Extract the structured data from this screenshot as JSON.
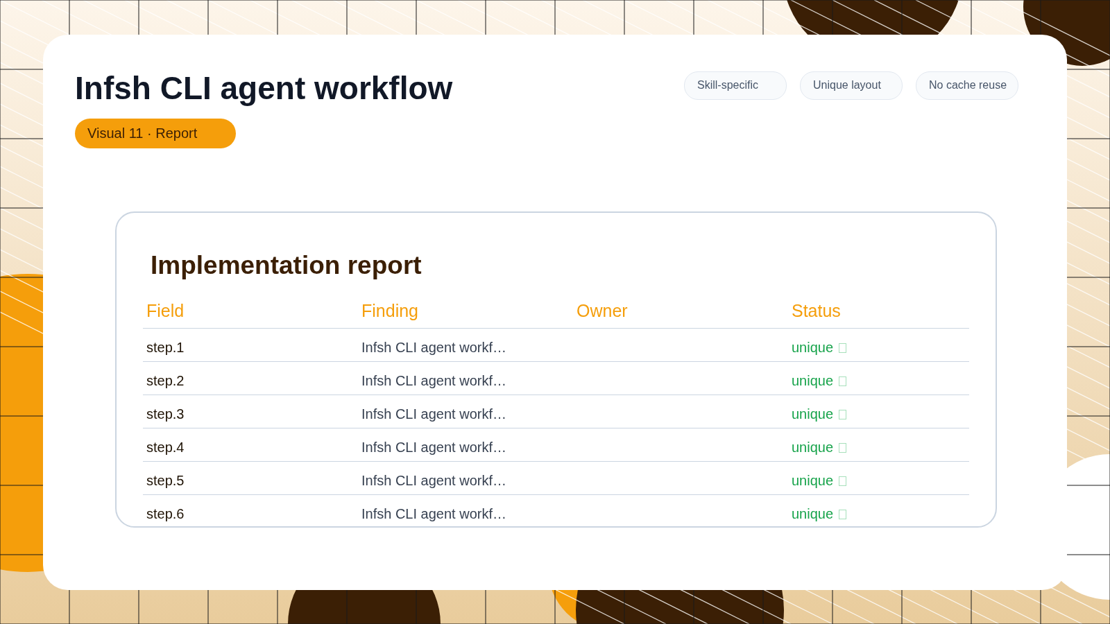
{
  "header": {
    "title": "Infsh CLI agent workflow",
    "badge": "Visual 11 · Report",
    "chips": [
      "Skill-specific",
      "Unique layout",
      "No cache reuse"
    ]
  },
  "report": {
    "title": "Implementation report",
    "columns": [
      "Field",
      "Finding",
      "Owner",
      "Status"
    ],
    "rows": [
      {
        "field": "step.1",
        "finding": "Infsh CLI agent workf…",
        "status": "unique"
      },
      {
        "field": "step.2",
        "finding": "Infsh CLI agent workf…",
        "status": "unique"
      },
      {
        "field": "step.3",
        "finding": "Infsh CLI agent workf…",
        "status": "unique"
      },
      {
        "field": "step.4",
        "finding": "Infsh CLI agent workf…",
        "status": "unique"
      },
      {
        "field": "step.5",
        "finding": "Infsh CLI agent workf…",
        "status": "unique"
      },
      {
        "field": "step.6",
        "finding": "Infsh CLI agent workf…",
        "status": "unique"
      }
    ]
  }
}
